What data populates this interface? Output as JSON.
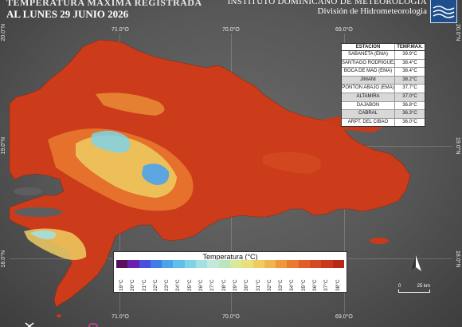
{
  "header": {
    "line1": "TEMPERATURA MÁXIMA REGISTRADA",
    "line2": "AL LUNES 29  JUNIO 2026",
    "institute": "INSTITUTO DOMINICANO DE METEOROLOGIA",
    "division": "División de Hidrometeorologia"
  },
  "coords": {
    "top": [
      "71.0°O",
      "70.0°O",
      "69.0°O"
    ],
    "bottom": [
      "71.0°O",
      "70.0°O",
      "69.0°O"
    ],
    "left": [
      "20.0°N",
      "19.0°N",
      "18.0°N"
    ],
    "right": [
      "20.0°N",
      "19.0°N",
      "18.0°N"
    ]
  },
  "stations": {
    "header_name": "ESTACION",
    "header_value": "TEMP.MAX.",
    "rows": [
      {
        "name": "SABANETA (EMA)",
        "value": "39.9°C"
      },
      {
        "name": "SANTIAGO RODRIGUEZ",
        "value": "38.4°C"
      },
      {
        "name": "BOCA DE MAD (EMA)",
        "value": "38.4°C"
      },
      {
        "name": "JIMANI",
        "value": "38.2°C"
      },
      {
        "name": "PONTÓN ABAJO (EMA)",
        "value": "37.7°C"
      },
      {
        "name": "ALTAMIRA",
        "value": "37.0°C"
      },
      {
        "name": "DAJABÓN",
        "value": "36.8°C"
      },
      {
        "name": "CABRAL",
        "value": "36.3°C"
      },
      {
        "name": "ARPT. DEL CIBAO",
        "value": "36.0°C"
      }
    ]
  },
  "legend": {
    "title": "Temperatura (°C)",
    "labels": [
      "19°C",
      "20°C",
      "21°C",
      "22°C",
      "23°C",
      "24°C",
      "25°C",
      "26°C",
      "27°C",
      "28°C",
      "29°C",
      "30°C",
      "31°C",
      "32°C",
      "33°C",
      "34°C",
      "35°C",
      "36°C",
      "37°C",
      "38°C"
    ],
    "colors": [
      "#5a0e5e",
      "#6a1fb0",
      "#4a4fe0",
      "#3f7ee8",
      "#4aa3ec",
      "#5fbfe8",
      "#7fd2e6",
      "#a3e0e4",
      "#c3e9dc",
      "#b9e6c0",
      "#d9e89a",
      "#e8e07a",
      "#efcc62",
      "#f0b44e",
      "#ee973c",
      "#e97a2f",
      "#e15e26",
      "#d44a22",
      "#c8391d",
      "#b52a18"
    ]
  },
  "scale": {
    "zero": "0",
    "distance": "25 km"
  },
  "north": "N"
}
